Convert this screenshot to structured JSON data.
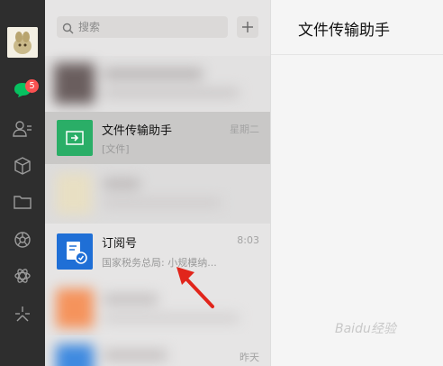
{
  "search": {
    "placeholder": "搜索"
  },
  "sidebar": {
    "unread_badge": "5"
  },
  "chats": [
    {
      "name": "",
      "time": "",
      "preview": ""
    },
    {
      "name": "文件传输助手",
      "time": "星期二",
      "preview": "[文件]"
    },
    {
      "name": "",
      "time": "",
      "preview": ""
    },
    {
      "name": "订阅号",
      "time": "8:03",
      "preview": "国家税务总局: 小规模纳..."
    },
    {
      "name": "",
      "time": "",
      "preview": ""
    },
    {
      "name": "",
      "time": "昨天",
      "preview": ""
    }
  ],
  "main": {
    "title": "文件传输助手"
  },
  "watermark": "Baidu经验"
}
